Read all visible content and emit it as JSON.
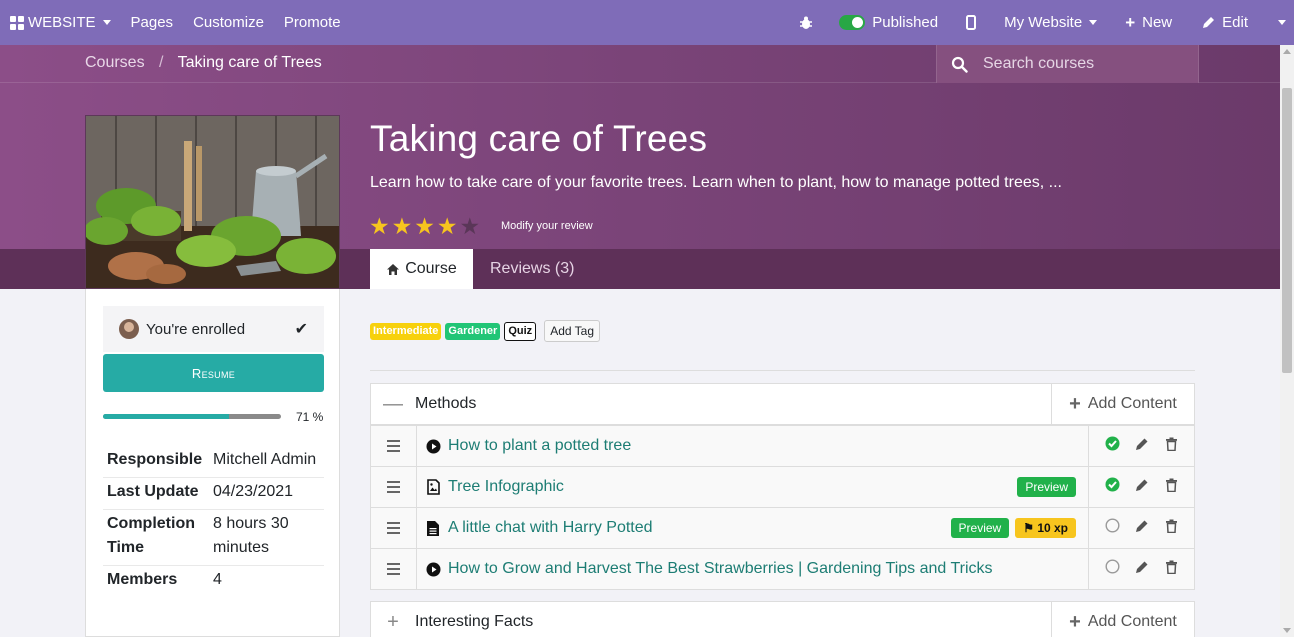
{
  "topbar": {
    "website_label": "WEBSITE",
    "pages_label": "Pages",
    "customize_label": "Customize",
    "promote_label": "Promote",
    "published_label": "Published",
    "my_website_label": "My Website",
    "new_label": "New",
    "edit_label": "Edit"
  },
  "breadcrumb": {
    "courses": "Courses",
    "sep": "/",
    "current": "Taking care of Trees"
  },
  "search": {
    "placeholder": "Search courses"
  },
  "course": {
    "title": "Taking care of Trees",
    "subtitle": "Learn how to take care of your favorite trees. Learn when to plant, how to manage potted trees, ...",
    "rating": 4,
    "rating_max": 5,
    "modify_review": "Modify your review"
  },
  "tabs": {
    "course": "Course",
    "reviews": "Reviews (3)"
  },
  "sidebar": {
    "enrolled": "You're enrolled",
    "resume": "Resume",
    "progress": 0.71,
    "progress_label": "71 %",
    "info": [
      {
        "label": "Responsible",
        "value": "Mitchell Admin"
      },
      {
        "label": "Last Update",
        "value": "04/23/2021"
      },
      {
        "label": "Completion Time",
        "value": "8 hours 30 minutes"
      },
      {
        "label": "Members",
        "value": "4"
      }
    ]
  },
  "tags": [
    "Intermediate",
    "Gardener",
    "Quiz"
  ],
  "add_tag": "Add Tag",
  "sections": [
    {
      "name": "Methods",
      "add": "Add Content"
    },
    {
      "name": "Interesting Facts",
      "add": "Add Content"
    }
  ],
  "contents": [
    {
      "title": "How to plant a potted tree",
      "type_icon": "play-circle-icon",
      "preview": "",
      "xp": "",
      "done": true
    },
    {
      "title": "Tree Infographic",
      "type_icon": "image-file-icon",
      "preview": "Preview",
      "xp": "",
      "done": true
    },
    {
      "title": "A little chat with Harry Potted",
      "type_icon": "document-icon",
      "preview": "Preview",
      "xp": "10 xp",
      "done": false
    },
    {
      "title": "How to Grow and Harvest The Best Strawberries | Gardening Tips and Tricks",
      "type_icon": "play-circle-icon",
      "preview": "",
      "xp": "",
      "done": false
    }
  ],
  "colors": {
    "accent": "#26aba5",
    "topbar": "#7f6cb8",
    "hero": "#7a4478",
    "link": "#1d7d74"
  }
}
